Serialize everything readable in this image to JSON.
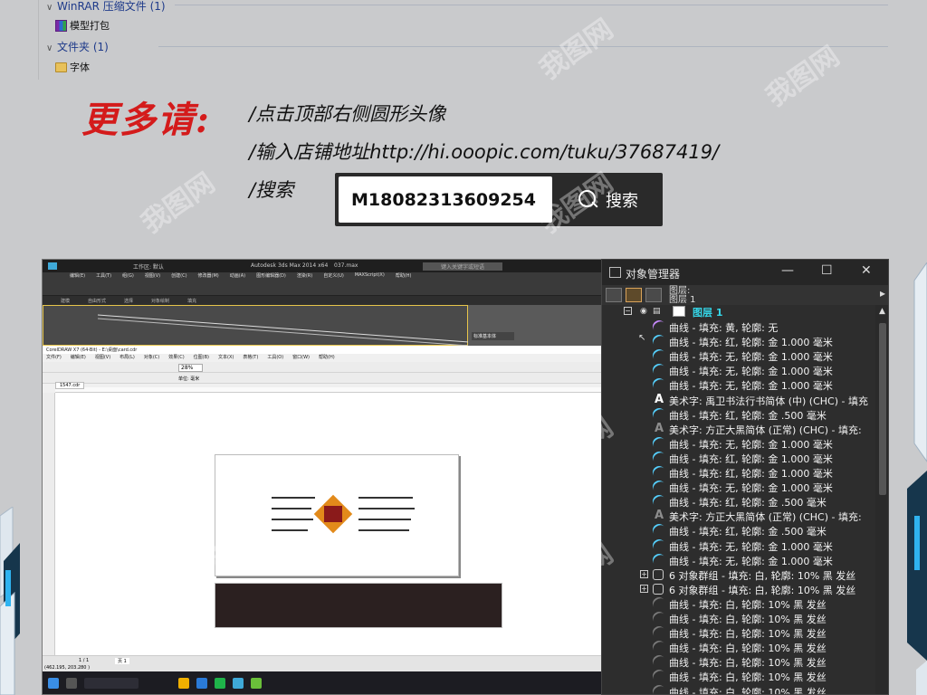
{
  "explorer": {
    "groups": [
      {
        "label": "WinRAR 压缩文件 (1)",
        "items": [
          "模型打包"
        ]
      },
      {
        "label": "文件夹 (1)",
        "items": [
          "字体"
        ]
      }
    ]
  },
  "promo": {
    "title": "更多请:",
    "lines": [
      "/点击顶部右侧圆形头像",
      "/输入店铺地址http://hi.ooopic.com/tuku/37687419/",
      "/搜索"
    ],
    "search_value": "M18082313609254",
    "search_button": "搜索"
  },
  "max": {
    "title": "Autodesk 3ds Max  2014 x64",
    "file": "037.max",
    "workspace": "工作区: 默认",
    "search_placeholder": "键入关键字或短语",
    "view": "视图",
    "menus": [
      "编辑(E)",
      "工具(T)",
      "组(G)",
      "视图(V)",
      "创建(C)",
      "修改器(M)",
      "动画(A)",
      "图形编辑器(D)",
      "渲染(R)",
      "自定义(U)",
      "MAXScript(X)",
      "帮助(H)"
    ],
    "tabs": [
      "建模",
      "自由形式",
      "选择",
      "对象绘制",
      "填充"
    ],
    "command_panel": "标准基本体"
  },
  "coreldraw": {
    "title": "CorelDRAW X7 (64-Bit) - E:\\桌面\\card.cdr",
    "menus": [
      "文件(F)",
      "编辑(E)",
      "视图(V)",
      "布局(L)",
      "对象(C)",
      "效果(C)",
      "位图(B)",
      "文本(X)",
      "表格(T)",
      "工具(O)",
      "窗口(W)",
      "帮助(H)"
    ],
    "zoom": "28%",
    "units": "单位: 毫米",
    "tab": "1547.cdr",
    "page_tab": "页 1",
    "page_counter": "1 / 1",
    "status_coords": "(462.195, 203.280 )"
  },
  "object_manager": {
    "title": "对象管理器",
    "header_lines": [
      "图层:",
      "图层 1"
    ],
    "layer_name": "图层 1",
    "rows": [
      {
        "icon": "curve-p",
        "text": "曲线 - 填充: 黄, 轮廓: 无"
      },
      {
        "icon": "curve-b",
        "text": "曲线 - 填充: 红, 轮廓: 金  1.000 毫米"
      },
      {
        "icon": "curve-b",
        "text": "曲线 - 填充: 无, 轮廓: 金  1.000 毫米"
      },
      {
        "icon": "curve-b",
        "text": "曲线 - 填充: 无, 轮廓: 金  1.000 毫米"
      },
      {
        "icon": "curve-b",
        "text": "曲线 - 填充: 无, 轮廓: 金  1.000 毫米"
      },
      {
        "icon": "art",
        "text": "美术字:  禹卫书法行书简体 (中) (CHC) - 填充"
      },
      {
        "icon": "curve-b",
        "text": "曲线 - 填充: 红, 轮廓: 金  .500 毫米"
      },
      {
        "icon": "art-dim",
        "text": "美术字:  方正大黑简体 (正常) (CHC) - 填充:"
      },
      {
        "icon": "curve-b",
        "text": "曲线 - 填充: 无, 轮廓: 金  1.000 毫米"
      },
      {
        "icon": "curve-b",
        "text": "曲线 - 填充: 红, 轮廓: 金  1.000 毫米"
      },
      {
        "icon": "curve-b",
        "text": "曲线 - 填充: 红, 轮廓: 金  1.000 毫米"
      },
      {
        "icon": "curve-b",
        "text": "曲线 - 填充: 无, 轮廓: 金  1.000 毫米"
      },
      {
        "icon": "curve-b",
        "text": "曲线 - 填充: 红, 轮廓: 金  .500 毫米"
      },
      {
        "icon": "art-dim",
        "text": "美术字:  方正大黑简体 (正常) (CHC) - 填充:"
      },
      {
        "icon": "curve-b",
        "text": "曲线 - 填充: 红, 轮廓: 金  .500 毫米"
      },
      {
        "icon": "curve-b",
        "text": "曲线 - 填充: 无, 轮廓: 金  1.000 毫米"
      },
      {
        "icon": "curve-b",
        "text": "曲线 - 填充: 无, 轮廓: 金  1.000 毫米"
      },
      {
        "icon": "group",
        "text": "6 对象群组 - 填充: 白, 轮廓: 10% 黑 发丝"
      },
      {
        "icon": "group",
        "text": "6 对象群组 - 填充: 白, 轮廓: 10% 黑 发丝"
      },
      {
        "icon": "curve-g",
        "text": "曲线 - 填充: 白, 轮廓: 10% 黑 发丝"
      },
      {
        "icon": "curve-g",
        "text": "曲线 - 填充: 白, 轮廓: 10% 黑 发丝"
      },
      {
        "icon": "curve-g",
        "text": "曲线 - 填充: 白, 轮廓: 10% 黑 发丝"
      },
      {
        "icon": "curve-g",
        "text": "曲线 - 填充: 白, 轮廓: 10% 黑 发丝"
      },
      {
        "icon": "curve-g",
        "text": "曲线 - 填充: 白, 轮廓: 10% 黑 发丝"
      },
      {
        "icon": "curve-g",
        "text": "曲线 - 填充: 白, 轮廓: 10% 黑 发丝"
      },
      {
        "icon": "curve-g",
        "text": "曲线 - 填充: 白, 轮廓: 10% 黑 发丝"
      },
      {
        "icon": "curve-g",
        "text": "曲线 - 填充: 白, 轮廓: 10% 黑 发丝"
      }
    ]
  },
  "colors": {
    "promo_title": "#d41b1b",
    "layer_name": "#35d6e8",
    "curve_icon": "#55d0ff",
    "panel_bg": "#2d2d2d"
  },
  "watermark": "我图网"
}
